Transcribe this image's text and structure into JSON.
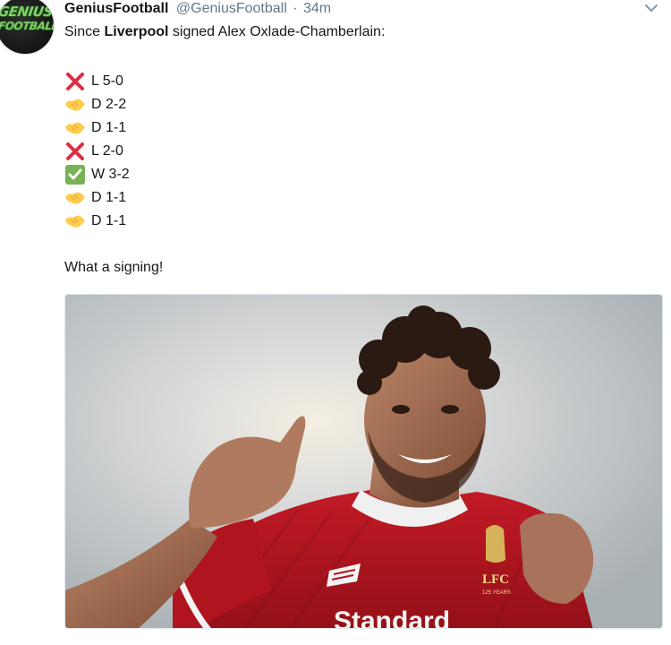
{
  "tweet": {
    "avatar": {
      "line1": "GENIUS",
      "line2": "FOOTBALL"
    },
    "author_name": "GeniusFootball",
    "handle": "@GeniusFootball",
    "separator": "·",
    "time": "34m",
    "text_before": "Since ",
    "text_bold": "Liverpool",
    "text_after": " signed Alex Oxlade-Chamberlain:",
    "results": [
      {
        "icon": "cross-mark-icon",
        "text": "L 5-0"
      },
      {
        "icon": "handshake-icon",
        "text": "D 2-2"
      },
      {
        "icon": "handshake-icon",
        "text": "D 1-1"
      },
      {
        "icon": "cross-mark-icon",
        "text": "L 2-0"
      },
      {
        "icon": "check-mark-icon",
        "text": "W 3-2"
      },
      {
        "icon": "handshake-icon",
        "text": "D 1-1"
      },
      {
        "icon": "handshake-icon",
        "text": "D 1-1"
      }
    ],
    "closing": "What a signing!",
    "photo": {
      "badge_text": "LFC",
      "badge_sub": "125 YEARS",
      "sponsor": "Standard"
    },
    "colors": {
      "cross": "#dd2e44",
      "check": "#77b255",
      "handshake": "#ffcc4d",
      "shirt": "#b3141f",
      "muted": "#657786"
    }
  }
}
